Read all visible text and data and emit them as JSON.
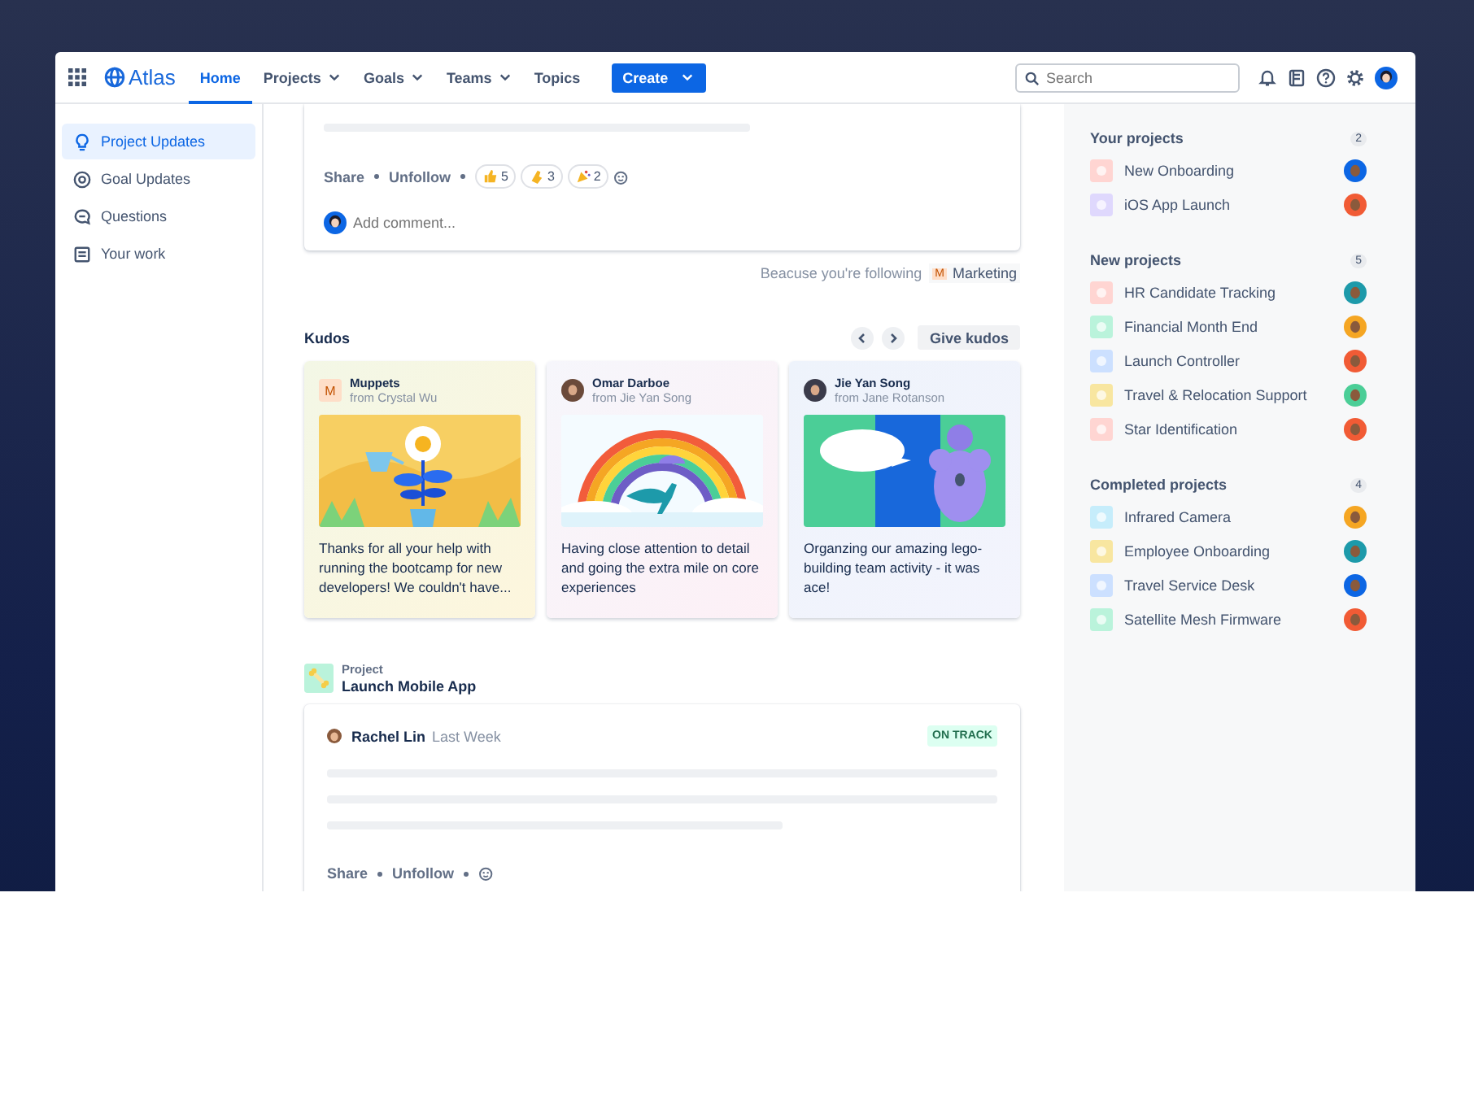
{
  "topbar": {
    "product": "Atlas",
    "nav": [
      {
        "label": "Home",
        "selected": true,
        "dropdown": false
      },
      {
        "label": "Projects",
        "selected": false,
        "dropdown": true
      },
      {
        "label": "Goals",
        "selected": false,
        "dropdown": true
      },
      {
        "label": "Teams",
        "selected": false,
        "dropdown": true
      },
      {
        "label": "Topics",
        "selected": false,
        "dropdown": false
      }
    ],
    "create": "Create",
    "search": {
      "placeholder": "Search"
    }
  },
  "sidebar": {
    "items": [
      {
        "label": "Project Updates",
        "selected": true
      },
      {
        "label": "Goal Updates",
        "selected": false
      },
      {
        "label": "Questions",
        "selected": false
      },
      {
        "label": "Your work",
        "selected": false
      }
    ]
  },
  "feed": {
    "first_update": {
      "actions": [
        "Share",
        "Unfollow"
      ],
      "reactions": [
        {
          "kind": "thumbs",
          "count": "5"
        },
        {
          "kind": "clap",
          "count": "3"
        },
        {
          "kind": "party",
          "count": "2"
        }
      ],
      "comment_placeholder": "Add comment...",
      "following_note": "Beacuse you're following",
      "following_badge": "M",
      "following_topic": "Marketing"
    },
    "kudos": {
      "title": "Kudos",
      "button": "Give kudos",
      "cards": [
        {
          "avatar": {
            "kind": "letter",
            "text": "M"
          },
          "name": "Muppets",
          "from": "from Crystal Wu",
          "message": "Thanks for all your help with running the bootcamp for new developers! We couldn't have..."
        },
        {
          "avatar": {
            "kind": "person",
            "color": "#6b4a3a"
          },
          "name": "Omar Darboe",
          "from": "from Jie Yan Song",
          "message": "Having close attention to detail and going the extra mile on core experiences"
        },
        {
          "avatar": {
            "kind": "person",
            "color": "#3b3b4a"
          },
          "name": "Jie Yan Song",
          "from": "from Jane Rotanson",
          "message": "Organzing our amazing lego-building team activity - it was ace!"
        }
      ]
    },
    "project_update": {
      "label": "Project",
      "name": "Launch Mobile App",
      "author": "Rachel Lin",
      "time": "Last Week",
      "status": {
        "kind": "on-track",
        "label": "ON TRACK"
      },
      "actions": [
        "Share",
        "Unfollow"
      ]
    }
  },
  "panel": {
    "sections": [
      {
        "title": "Your projects",
        "count": "2",
        "items": [
          {
            "name": "New Onboarding",
            "icon": {
              "color": "#ffd5d2"
            },
            "avatar": {
              "color": "#0c66e4"
            }
          },
          {
            "name": "iOS App Launch",
            "icon": {
              "color": "#dfd8fd"
            },
            "avatar": {
              "color": "#f15b35"
            }
          }
        ]
      },
      {
        "title": "New projects",
        "count": "5",
        "items": [
          {
            "name": "HR Candidate Tracking",
            "icon": {
              "color": "#ffd5d2"
            },
            "avatar": {
              "color": "#1d9aaa"
            }
          },
          {
            "name": "Financial Month End",
            "icon": {
              "color": "#baf3db"
            },
            "avatar": {
              "color": "#f5a623"
            }
          },
          {
            "name": "Launch Controller",
            "icon": {
              "color": "#cce0ff"
            },
            "avatar": {
              "color": "#f15b35"
            }
          },
          {
            "name": "Travel & Relocation Support",
            "icon": {
              "color": "#f8e6a0"
            },
            "avatar": {
              "color": "#4bce97"
            }
          },
          {
            "name": "Star Identification",
            "icon": {
              "color": "#ffd5d2"
            },
            "avatar": {
              "color": "#f15b35"
            }
          }
        ]
      },
      {
        "title": "Completed projects",
        "count": "4",
        "items": [
          {
            "name": "Infrared Camera",
            "icon": {
              "color": "#c6edfb"
            },
            "avatar": {
              "color": "#f5a623"
            }
          },
          {
            "name": "Employee Onboarding",
            "icon": {
              "color": "#f8e6a0"
            },
            "avatar": {
              "color": "#1d9aaa"
            }
          },
          {
            "name": "Travel Service Desk",
            "icon": {
              "color": "#cce0ff"
            },
            "avatar": {
              "color": "#0c66e4"
            }
          },
          {
            "name": "Satellite Mesh Firmware",
            "icon": {
              "color": "#baf3db"
            },
            "avatar": {
              "color": "#f15b35"
            }
          }
        ]
      }
    ]
  }
}
